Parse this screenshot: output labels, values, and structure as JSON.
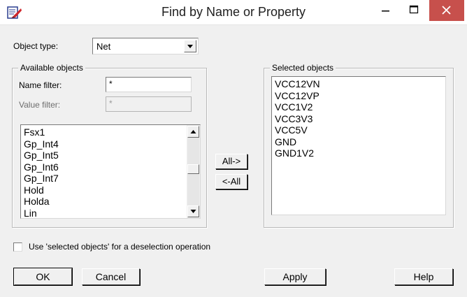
{
  "window": {
    "title": "Find by Name or Property"
  },
  "object_type": {
    "label": "Object type:",
    "selected": "Net"
  },
  "available": {
    "group_title": "Available objects",
    "name_filter_label": "Name filter:",
    "name_filter_value": "*",
    "value_filter_label": "Value filter:",
    "value_filter_value": "*",
    "items": [
      "Fsx1",
      "Gp_Int4",
      "Gp_Int5",
      "Gp_Int6",
      "Gp_Int7",
      "Hold",
      "Holda",
      "Lin"
    ]
  },
  "transfer": {
    "all_right_label": "All->",
    "all_left_label": "<-All"
  },
  "selected": {
    "group_title": "Selected objects",
    "items": [
      "VCC12VN",
      "VCC12VP",
      "VCC1V2",
      "VCC3V3",
      "VCC5V",
      "GND",
      "GND1V2"
    ]
  },
  "options": {
    "deselect_label": "Use 'selected objects' for a deselection operation",
    "deselect_checked": false
  },
  "buttons": {
    "ok": "OK",
    "cancel": "Cancel",
    "apply": "Apply",
    "help": "Help"
  },
  "colors": {
    "close_button": "#c7504c",
    "window_bg": "#f0f0f0"
  },
  "icons": {
    "app": "find-property-icon",
    "minimize": "minimize-icon",
    "maximize": "maximize-icon",
    "close": "close-icon",
    "dropdown": "chevron-down-icon",
    "scroll_up": "scroll-up-arrow-icon",
    "scroll_down": "scroll-down-arrow-icon"
  }
}
